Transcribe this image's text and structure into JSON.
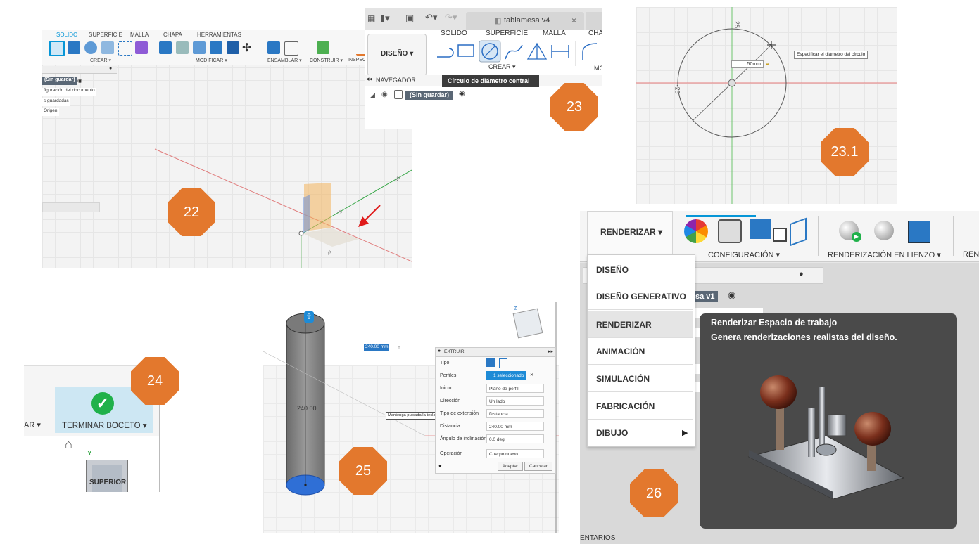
{
  "badges": {
    "b22": "22",
    "b23": "23",
    "b231": "23.1",
    "b24": "24",
    "b25": "25",
    "b26": "26"
  },
  "colors": {
    "badge": "#e3782d",
    "accent": "#0696d7",
    "green_axis": "#3aa84a",
    "red_axis": "#d94a4a"
  },
  "p22": {
    "tabs": [
      "SOLIDO",
      "SUPERFICIE",
      "MALLA",
      "CHAPA",
      "HERRAMIENTAS"
    ],
    "groups": [
      "CREAR ▾",
      "MODIFICAR ▾",
      "ENSAMBLAR ▾",
      "CONSTRUIR ▾",
      "INSPECC"
    ],
    "browser": [
      "(Sin guardar)",
      "figuración del documento",
      "s guardadas",
      "Origen"
    ],
    "labels": {
      "top_axis": "15",
      "mid_axis": "25",
      "low_axis": "25"
    }
  },
  "p23": {
    "doc_tab": "tablamesa v4",
    "workspace": "DISEÑO ▾",
    "tabs": [
      "SOLIDO",
      "SUPERFICIE",
      "MALLA",
      "CHAP"
    ],
    "group": "CREAR ▾",
    "group_right": "MC",
    "nav": "NAVEGADOR",
    "tooltip": "Círculo de diámetro central",
    "browser_item": "(Sin guardar)"
  },
  "p231": {
    "dim": "50mm",
    "hint": "Especificar el diámetro del círculo",
    "tick_top": "25",
    "tick_left": "-25"
  },
  "p24": {
    "left_label": "AR ▾",
    "finish": "TERMINAR BOCETO ▾",
    "axis": "Y",
    "view": "SUPERIOR"
  },
  "p25": {
    "dim_input": "240.00 mm",
    "height_label": "240.00",
    "hint": "Mantenga pulsada la tecla Ctrl para modificar la selección",
    "dialog_title": "EXTRUIR",
    "rows": [
      {
        "label": "Tipo",
        "value": ""
      },
      {
        "label": "Perfiles",
        "value": "1 seleccionado"
      },
      {
        "label": "Inicio",
        "value": "Plano de perfil"
      },
      {
        "label": "Dirección",
        "value": "Un lado"
      },
      {
        "label": "Tipo de extensión",
        "value": "Distancia"
      },
      {
        "label": "Distancia",
        "value": "240.00 mm"
      },
      {
        "label": "Ángulo de inclinación",
        "value": "0.0 deg"
      }
    ],
    "operation_label": "Operación",
    "operation_value": "Cuerpo nuevo",
    "ok": "Aceptar",
    "cancel": "Cancelar"
  },
  "p26": {
    "workspace": "RENDERIZAR ▾",
    "group1": "CONFIGURACIÓN ▾",
    "group2": "RENDERIZACIÓN EN LIENZO ▾",
    "group3": "REN",
    "menu": [
      "DISEÑO",
      "DISEÑO GENERATIVO",
      "RENDERIZAR",
      "ANIMACIÓN",
      "SIMULACIÓN",
      "FABRICACIÓN",
      "DIBUJO"
    ],
    "browser_item": "sa v1",
    "tooltip_title": "Renderizar Espacio de trabajo",
    "tooltip_desc": "Genera renderizaciones realistas del diseño.",
    "bottom": "ENTARIOS"
  }
}
